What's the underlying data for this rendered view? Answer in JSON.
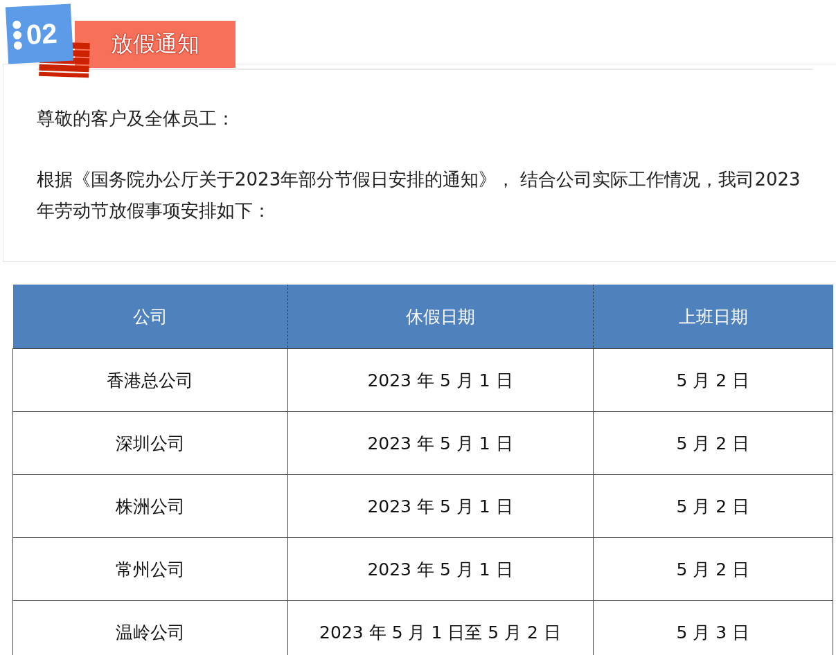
{
  "section": {
    "number": "02",
    "title": "放假通知"
  },
  "notice": {
    "greeting": "尊敬的客户及全体员工：",
    "paragraph": "根据《国务院办公厅关于2023年部分节假日安排的通知》， 结合公司实际工作情况，我司2023年劳动节放假事项安排如下："
  },
  "table": {
    "columns": [
      "公司",
      "休假日期",
      "上班日期"
    ],
    "rows": [
      [
        "香港总公司",
        "2023 年 5 月 1 日",
        "5 月 2 日"
      ],
      [
        "深圳公司",
        "2023 年 5 月 1 日",
        "5 月 2 日"
      ],
      [
        "株洲公司",
        "2023 年 5 月 1 日",
        "5 月 2 日"
      ],
      [
        "常州公司",
        "2023 年 5 月 1 日",
        "5 月 2 日"
      ],
      [
        "温岭公司",
        "2023 年 5 月 1 日至 5 月 2 日",
        "5 月 3 日"
      ]
    ]
  }
}
